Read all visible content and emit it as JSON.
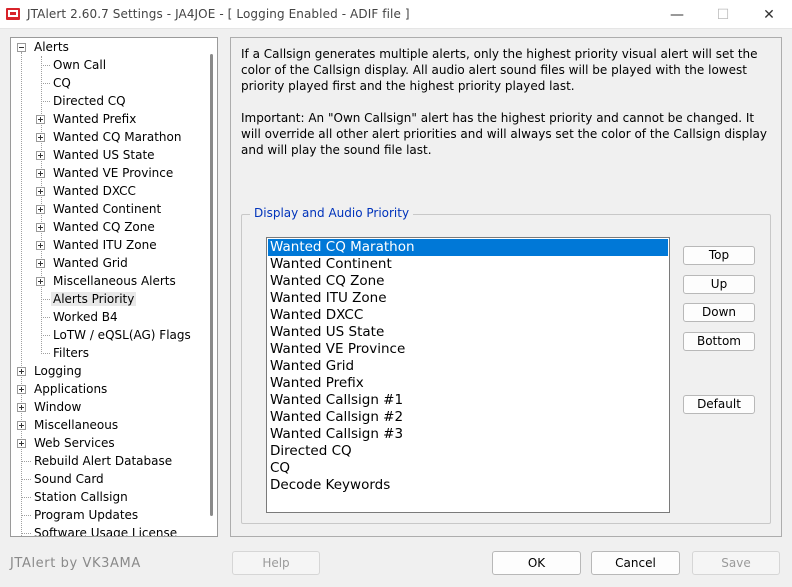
{
  "window": {
    "title": "JTAlert 2.60.7 Settings  -  JA4JOE  -  [ Logging Enabled - ADIF file ]",
    "min_icon": "minimize-icon",
    "max_icon": "maximize-icon",
    "close_icon": "close-icon",
    "min_glyph": "—",
    "max_glyph": "☐",
    "close_glyph": "✕"
  },
  "tree": {
    "items": [
      {
        "label": "Alerts",
        "level": 0,
        "expander": "minus"
      },
      {
        "label": "Own Call",
        "level": 1,
        "expander": "none"
      },
      {
        "label": "CQ",
        "level": 1,
        "expander": "none"
      },
      {
        "label": "Directed CQ",
        "level": 1,
        "expander": "none"
      },
      {
        "label": "Wanted Prefix",
        "level": 1,
        "expander": "plus"
      },
      {
        "label": "Wanted CQ Marathon",
        "level": 1,
        "expander": "plus"
      },
      {
        "label": "Wanted US State",
        "level": 1,
        "expander": "plus"
      },
      {
        "label": "Wanted VE Province",
        "level": 1,
        "expander": "plus"
      },
      {
        "label": "Wanted DXCC",
        "level": 1,
        "expander": "plus"
      },
      {
        "label": "Wanted Continent",
        "level": 1,
        "expander": "plus"
      },
      {
        "label": "Wanted CQ Zone",
        "level": 1,
        "expander": "plus"
      },
      {
        "label": "Wanted ITU Zone",
        "level": 1,
        "expander": "plus"
      },
      {
        "label": "Wanted Grid",
        "level": 1,
        "expander": "plus"
      },
      {
        "label": "Miscellaneous Alerts",
        "level": 1,
        "expander": "plus"
      },
      {
        "label": "Alerts Priority",
        "level": 1,
        "expander": "none",
        "selected": true
      },
      {
        "label": "Worked B4",
        "level": 1,
        "expander": "none"
      },
      {
        "label": "LoTW / eQSL(AG) Flags",
        "level": 1,
        "expander": "none"
      },
      {
        "label": "Filters",
        "level": 1,
        "expander": "none"
      },
      {
        "label": "Logging",
        "level": 0,
        "expander": "plus"
      },
      {
        "label": "Applications",
        "level": 0,
        "expander": "plus"
      },
      {
        "label": "Window",
        "level": 0,
        "expander": "plus"
      },
      {
        "label": "Miscellaneous",
        "level": 0,
        "expander": "plus"
      },
      {
        "label": "Web Services",
        "level": 0,
        "expander": "plus"
      },
      {
        "label": "Rebuild Alert Database",
        "level": 0,
        "expander": "none"
      },
      {
        "label": "Sound Card",
        "level": 0,
        "expander": "none"
      },
      {
        "label": "Station Callsign",
        "level": 0,
        "expander": "none"
      },
      {
        "label": "Program Updates",
        "level": 0,
        "expander": "none"
      },
      {
        "label": "Software Usage License",
        "level": 0,
        "expander": "none"
      }
    ]
  },
  "panel": {
    "description_1": "If a Callsign generates multiple alerts, only the highest priority visual alert will set the color of the Callsign display. All audio alert sound files will be played with the lowest priority played first and the highest priority played last.",
    "description_2": "Important: An \"Own Callsign\" alert has the highest priority and cannot be changed. It will override all other alert priorities and will always set the color of the Callsign display and will play the sound file last.",
    "group_title": "Display and Audio Priority",
    "priority_list": [
      "Wanted CQ Marathon",
      "Wanted Continent",
      "Wanted CQ Zone",
      "Wanted ITU Zone",
      "Wanted DXCC",
      "Wanted US State",
      "Wanted VE Province",
      "Wanted Grid",
      "Wanted Prefix",
      "Wanted Callsign #1",
      "Wanted Callsign #2",
      "Wanted Callsign #3",
      "Directed CQ",
      "CQ",
      "Decode Keywords"
    ],
    "selected_index": 0,
    "buttons": {
      "top": "Top",
      "up": "Up",
      "down": "Down",
      "bottom": "Bottom",
      "default": "Default"
    }
  },
  "footer": {
    "brand": "JTAlert by VK3AMA",
    "help": "Help",
    "ok": "OK",
    "cancel": "Cancel",
    "save": "Save"
  },
  "colors": {
    "selection": "#0078d7",
    "group_title": "#0033bb"
  }
}
